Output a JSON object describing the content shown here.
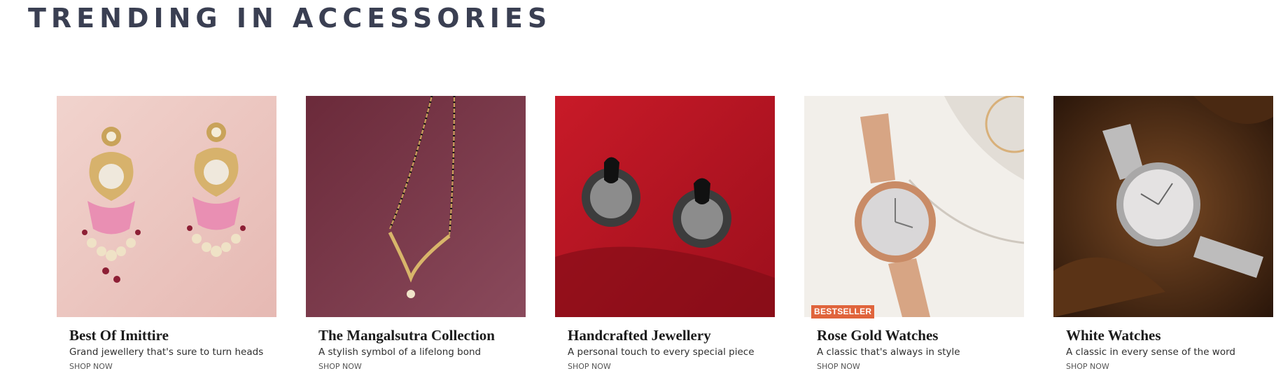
{
  "section": {
    "title": "TRENDING IN ACCESSORIES"
  },
  "cards": [
    {
      "title": "Best Of Imittire",
      "description": "Grand jewellery that's sure to turn heads",
      "cta": "SHOP NOW",
      "image_icon": "earrings-image"
    },
    {
      "title": "The Mangalsutra Collection",
      "description": "A stylish symbol of a lifelong bond",
      "cta": "SHOP NOW",
      "image_icon": "mangalsutra-image"
    },
    {
      "title": "Handcrafted Jewellery",
      "description": "A personal touch to every special piece",
      "cta": "SHOP NOW",
      "image_icon": "oxidised-earrings-image"
    },
    {
      "title": "Rose Gold Watches",
      "description": "A classic that's always in style",
      "cta": "SHOP NOW",
      "badge": "BESTSELLER",
      "image_icon": "rose-gold-watch-image"
    },
    {
      "title": "White Watches",
      "description": "A classic in every sense of the word",
      "cta": "SHOP NOW",
      "image_icon": "white-watch-image"
    }
  ],
  "colors": {
    "title": "#3a3f52",
    "badge": "#e0643c"
  }
}
